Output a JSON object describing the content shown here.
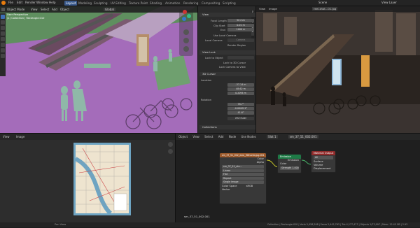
{
  "topbar": {
    "menus": [
      "File",
      "Edit",
      "Render",
      "Window",
      "Help"
    ],
    "workspaces": [
      "Layout",
      "Modeling",
      "Sculpting",
      "UV Editing",
      "Texture Paint",
      "Shading",
      "Animation",
      "Rendering",
      "Compositing",
      "Scripting"
    ],
    "scene": "Scene",
    "view_layer": "View Layer"
  },
  "viewport": {
    "mode": "Object Mode",
    "menus": [
      "View",
      "Select",
      "Add",
      "Object"
    ],
    "orientation": "Global",
    "info_line1": "User Perspective",
    "info_line2": "(1) Collection | Rectangle.010"
  },
  "properties": {
    "tabs": [
      "Item",
      "Tool",
      "View"
    ],
    "view": {
      "focal_length_label": "Focal Length",
      "focal_length": "50 mm",
      "clip_start_label": "Clip Start",
      "clip_start": "0.01 m",
      "end_label": "End",
      "end": "1000 m",
      "use_local_camera": "Use Local Camera",
      "local_camera_label": "Local Camera",
      "local_camera": "Camera",
      "render_region": "Render Region"
    },
    "view_lock": {
      "title": "View Lock",
      "lock_to_object_label": "Lock to Object",
      "lock_to_3d_cursor": "Lock to 3D Cursor",
      "lock_camera_to_view": "Lock Camera to View"
    },
    "cursor": {
      "title": "3D Cursor",
      "location_label": "Location",
      "loc": [
        "-37.14 m",
        "48.62 m",
        "0.2094 m"
      ],
      "rotation_label": "Rotation",
      "rot": [
        "78.7°",
        "-0.000011°",
        "41.6°"
      ],
      "rot_mode": "XYZ Euler"
    },
    "collections": "Collections"
  },
  "render_view": {
    "menus": [
      "View",
      "Image"
    ],
    "image": "reel-shot...01.jpg"
  },
  "image_editor": {
    "menus": [
      "View",
      "Image"
    ],
    "image_name": "sm_37_51_002.001"
  },
  "node_editor": {
    "menus": [
      "Object",
      "View",
      "Select",
      "Add",
      "Node"
    ],
    "use_nodes": "Use Nodes",
    "slot": "Slot 1",
    "material": "sm_37_51_002.001",
    "nodes": {
      "texture": {
        "title": "sm_37_51_002_ezra_fitthumb.jpg.001",
        "out_color": "Color",
        "out_alpha": "Alpha",
        "img": "sm_37_51_sks...",
        "interp": "Linear",
        "proj": "Flat",
        "ext": "Repeat",
        "source": "Single Image",
        "colorspace_label": "Color Space",
        "colorspace": "sRGB",
        "vector": "Vector"
      },
      "emission": {
        "title": "Emission",
        "out": "Emission",
        "color": "Color",
        "strength_label": "Strength",
        "strength": "1.000"
      },
      "output": {
        "title": "Material Output",
        "target": "All",
        "surface": "Surface",
        "volume": "Volume",
        "displacement": "Displacement"
      }
    }
  },
  "status": {
    "left": "Pan View",
    "right": "Collection | Rectangle.010 | Verts 5,458,208 | Faces 2,442,763 | Tris 4,177,477 | Objects 1/73,997 | Mem: 12.45 GB | 2.93"
  },
  "colors": {
    "accent": "#3d6fb6",
    "viewport_bg": "#9b6fb0",
    "node_texture": "#9c5a2c",
    "node_emission": "#1e7a46",
    "node_output": "#8f2a2a"
  }
}
